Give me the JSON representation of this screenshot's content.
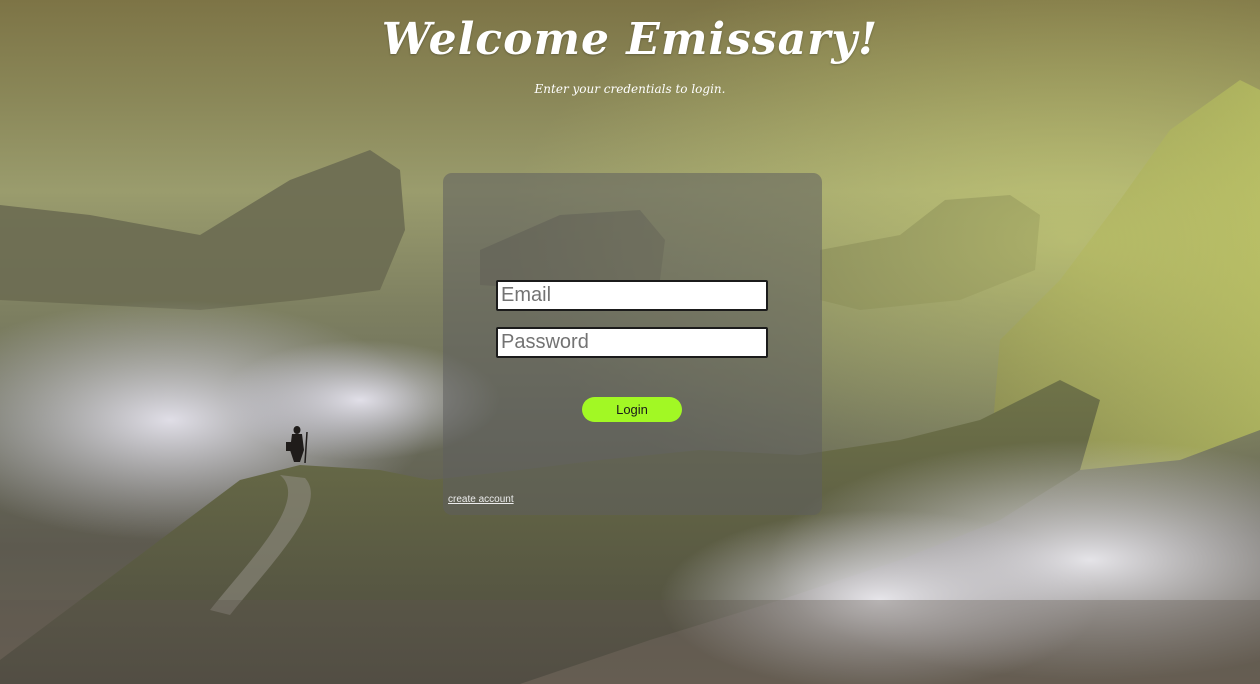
{
  "header": {
    "title": "Welcome Emissary!",
    "subtitle": "Enter your credentials to login."
  },
  "login_form": {
    "email_placeholder": "Email",
    "password_placeholder": "Password",
    "login_label": "Login",
    "create_account_label": "create account"
  },
  "colors": {
    "login_button": "#a2f824",
    "panel": "#5f5f5f"
  }
}
